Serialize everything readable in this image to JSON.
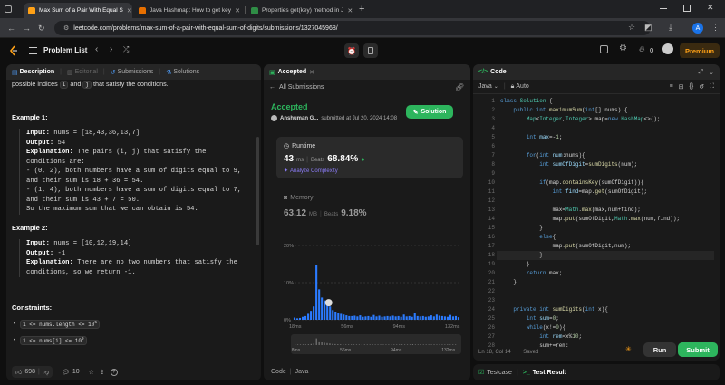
{
  "browser": {
    "tabs": [
      {
        "title": "Max Sum of a Pair With Equal S"
      },
      {
        "title": "Java Hashmap: How to get key"
      },
      {
        "title": "Properties get(key) method in J"
      }
    ],
    "new_tab": "+",
    "url": "leetcode.com/problems/max-sum-of-a-pair-with-equal-sum-of-digits/submissions/1327045968/",
    "profile_initial": "A"
  },
  "header": {
    "problem_list": "Problem List",
    "streak_count": "0",
    "premium": "Premium"
  },
  "left_panel": {
    "tabs": {
      "description": "Description",
      "editorial": "Editorial",
      "submissions": "Submissions",
      "solutions": "Solutions"
    },
    "intro_text": {
      "pre": "possible indices ",
      "i": "i",
      "mid": " and ",
      "j": "j",
      "post": " that satisfy the conditions."
    },
    "example1": {
      "heading": "Example 1:",
      "input_label": "Input:",
      "input_value": " nums = [18,43,36,13,7]",
      "output_label": "Output:",
      "output_value": " 54",
      "explanation_label": "Explanation:",
      "lines": [
        " The pairs (i, j) that satisfy the",
        "conditions are:",
        "- (0, 2), both numbers have a sum of digits equal to 9,",
        "and their sum is 18 + 36 = 54.",
        "- (1, 4), both numbers have a sum of digits equal to 7,",
        "and their sum is 43 + 7 = 50.",
        "So the maximum sum that we can obtain is 54."
      ]
    },
    "example2": {
      "heading": "Example 2:",
      "input_label": "Input:",
      "input_value": " nums = [10,12,19,14]",
      "output_label": "Output:",
      "output_value": " -1",
      "explanation_label": "Explanation:",
      "lines": [
        " There are no two numbers that satisfy the",
        "conditions, so we return -1."
      ]
    },
    "constraints": {
      "heading": "Constraints:",
      "items": [
        {
          "text": "1 <= nums.length <= 10",
          "sup": "5"
        },
        {
          "text": "1 <= nums[i] <= 10",
          "sup": "9"
        }
      ]
    },
    "likes": "698",
    "comments": "10"
  },
  "middle_panel": {
    "tab": "Accepted",
    "back": "All Submissions",
    "status": "Accepted",
    "user": "Anshuman G...",
    "submitted": "submitted at Jul 20, 2024 14:08",
    "solution_button": "Solution",
    "runtime": {
      "label": "Runtime",
      "value": "43",
      "unit": "ms",
      "beats_label": "Beats",
      "beats": "68.84%",
      "analyze": "Analyze Complexity"
    },
    "memory": {
      "label": "Memory",
      "value": "63.12",
      "unit": "MB",
      "beats_label": "Beats",
      "beats": "9.18%"
    },
    "chart_data": {
      "type": "bar",
      "title": "",
      "xlabel": "",
      "ylabel": "",
      "ylim": [
        0,
        20
      ],
      "y_ticks": [
        "20%",
        "10%",
        "0%"
      ],
      "x_ticks": [
        "18ms",
        "56ms",
        "94ms",
        "132ms"
      ],
      "xlim": [
        18,
        140
      ],
      "grid": true,
      "bar_color": "#2b7bff",
      "highlight_x": 43,
      "bars": [
        {
          "x": 18,
          "y": 0.6
        },
        {
          "x": 20,
          "y": 0.4
        },
        {
          "x": 22,
          "y": 0.5
        },
        {
          "x": 24,
          "y": 0.8
        },
        {
          "x": 26,
          "y": 1.0
        },
        {
          "x": 28,
          "y": 1.6
        },
        {
          "x": 30,
          "y": 2.4
        },
        {
          "x": 32,
          "y": 3.6
        },
        {
          "x": 34,
          "y": 14.8
        },
        {
          "x": 36,
          "y": 8.2
        },
        {
          "x": 38,
          "y": 6.0
        },
        {
          "x": 40,
          "y": 5.2
        },
        {
          "x": 42,
          "y": 4.4
        },
        {
          "x": 44,
          "y": 3.6
        },
        {
          "x": 46,
          "y": 2.6
        },
        {
          "x": 48,
          "y": 2.2
        },
        {
          "x": 50,
          "y": 1.8
        },
        {
          "x": 52,
          "y": 1.6
        },
        {
          "x": 54,
          "y": 1.4
        },
        {
          "x": 56,
          "y": 1.2
        },
        {
          "x": 58,
          "y": 1.0
        },
        {
          "x": 60,
          "y": 1.0
        },
        {
          "x": 62,
          "y": 1.1
        },
        {
          "x": 64,
          "y": 0.9
        },
        {
          "x": 66,
          "y": 1.2
        },
        {
          "x": 68,
          "y": 0.8
        },
        {
          "x": 70,
          "y": 0.9
        },
        {
          "x": 72,
          "y": 1.0
        },
        {
          "x": 74,
          "y": 0.8
        },
        {
          "x": 76,
          "y": 1.3
        },
        {
          "x": 78,
          "y": 0.9
        },
        {
          "x": 80,
          "y": 1.1
        },
        {
          "x": 82,
          "y": 0.8
        },
        {
          "x": 84,
          "y": 0.9
        },
        {
          "x": 86,
          "y": 1.0
        },
        {
          "x": 88,
          "y": 0.9
        },
        {
          "x": 90,
          "y": 1.1
        },
        {
          "x": 92,
          "y": 0.9
        },
        {
          "x": 94,
          "y": 1.0
        },
        {
          "x": 96,
          "y": 0.8
        },
        {
          "x": 98,
          "y": 1.4
        },
        {
          "x": 100,
          "y": 0.9
        },
        {
          "x": 102,
          "y": 1.0
        },
        {
          "x": 104,
          "y": 0.8
        },
        {
          "x": 106,
          "y": 1.8
        },
        {
          "x": 108,
          "y": 1.0
        },
        {
          "x": 110,
          "y": 0.9
        },
        {
          "x": 112,
          "y": 1.0
        },
        {
          "x": 114,
          "y": 0.8
        },
        {
          "x": 116,
          "y": 0.9
        },
        {
          "x": 118,
          "y": 1.2
        },
        {
          "x": 120,
          "y": 0.9
        },
        {
          "x": 122,
          "y": 1.4
        },
        {
          "x": 124,
          "y": 1.1
        },
        {
          "x": 126,
          "y": 1.0
        },
        {
          "x": 128,
          "y": 0.9
        },
        {
          "x": 130,
          "y": 0.8
        },
        {
          "x": 132,
          "y": 1.3
        },
        {
          "x": 134,
          "y": 0.9
        },
        {
          "x": 136,
          "y": 1.0
        },
        {
          "x": 138,
          "y": 0.7
        }
      ],
      "overview_ticks": [
        "18ms",
        "56ms",
        "94ms",
        "132ms"
      ]
    },
    "footer": {
      "code_label": "Code",
      "lang": "Java"
    }
  },
  "right_panel": {
    "tab": "Code",
    "lang": "Java",
    "auto": "Auto",
    "lines": [
      {
        "n": "1",
        "code": [
          [
            "kw",
            "class "
          ],
          [
            "ty",
            "Solution "
          ],
          [
            "pl",
            "{"
          ]
        ]
      },
      {
        "n": "2",
        "code": [
          [
            "pl",
            "    "
          ],
          [
            "kw",
            "public int "
          ],
          [
            "fn",
            "maximumSum"
          ],
          [
            "pl",
            "("
          ],
          [
            "kw",
            "int"
          ],
          [
            "pl",
            "[] nums) {"
          ]
        ]
      },
      {
        "n": "3",
        "code": [
          [
            "pl",
            "        "
          ],
          [
            "ty",
            "Map"
          ],
          [
            "pl",
            "<"
          ],
          [
            "ty",
            "Integer"
          ],
          [
            "pl",
            ","
          ],
          [
            "ty",
            "Integer"
          ],
          [
            "pl",
            "> map="
          ],
          [
            "kw",
            "new "
          ],
          [
            "ty",
            "HashMap"
          ],
          [
            "pl",
            "<>();"
          ]
        ]
      },
      {
        "n": "4",
        "code": []
      },
      {
        "n": "5",
        "code": [
          [
            "pl",
            "        "
          ],
          [
            "kw",
            "int "
          ],
          [
            "vr",
            "max"
          ],
          [
            "pl",
            "=-"
          ],
          [
            "nm",
            "1"
          ],
          [
            "pl",
            ";"
          ]
        ]
      },
      {
        "n": "6",
        "code": []
      },
      {
        "n": "7",
        "code": [
          [
            "pl",
            "        "
          ],
          [
            "kw",
            "for"
          ],
          [
            "pl",
            "("
          ],
          [
            "kw",
            "int "
          ],
          [
            "vr",
            "num"
          ],
          [
            "pl",
            ":nums){"
          ]
        ]
      },
      {
        "n": "8",
        "code": [
          [
            "pl",
            "            "
          ],
          [
            "kw",
            "int "
          ],
          [
            "vr",
            "sumOfDigit"
          ],
          [
            "pl",
            "="
          ],
          [
            "fn",
            "sumDigits"
          ],
          [
            "pl",
            "(num);"
          ]
        ]
      },
      {
        "n": "9",
        "code": []
      },
      {
        "n": "10",
        "code": [
          [
            "pl",
            "            "
          ],
          [
            "kw",
            "if"
          ],
          [
            "pl",
            "(map."
          ],
          [
            "fn",
            "containsKey"
          ],
          [
            "pl",
            "(sumOfDigit)){"
          ]
        ]
      },
      {
        "n": "11",
        "code": [
          [
            "pl",
            "                "
          ],
          [
            "kw",
            "int "
          ],
          [
            "vr",
            "find"
          ],
          [
            "pl",
            "=map."
          ],
          [
            "fn",
            "get"
          ],
          [
            "pl",
            "(sumOfDigit);"
          ]
        ]
      },
      {
        "n": "12",
        "code": []
      },
      {
        "n": "13",
        "code": [
          [
            "pl",
            "                max="
          ],
          [
            "ty",
            "Math"
          ],
          [
            "pl",
            "."
          ],
          [
            "fn",
            "max"
          ],
          [
            "pl",
            "(max,num+find);"
          ]
        ]
      },
      {
        "n": "14",
        "code": [
          [
            "pl",
            "                map."
          ],
          [
            "fn",
            "put"
          ],
          [
            "pl",
            "(sumOfDigit,"
          ],
          [
            "ty",
            "Math"
          ],
          [
            "pl",
            "."
          ],
          [
            "fn",
            "max"
          ],
          [
            "pl",
            "(num,find));"
          ]
        ]
      },
      {
        "n": "15",
        "code": [
          [
            "pl",
            "            }"
          ]
        ]
      },
      {
        "n": "16",
        "code": [
          [
            "pl",
            "            "
          ],
          [
            "kw",
            "else"
          ],
          [
            "pl",
            "{"
          ]
        ]
      },
      {
        "n": "17",
        "code": [
          [
            "pl",
            "                map."
          ],
          [
            "fn",
            "put"
          ],
          [
            "pl",
            "(sumOfDigit,num);"
          ]
        ]
      },
      {
        "n": "18",
        "code": [
          [
            "pl",
            "            }"
          ]
        ]
      },
      {
        "n": "19",
        "code": [
          [
            "pl",
            "        }"
          ]
        ]
      },
      {
        "n": "20",
        "code": [
          [
            "pl",
            "        "
          ],
          [
            "kw",
            "return "
          ],
          [
            "pl",
            "max;"
          ]
        ]
      },
      {
        "n": "21",
        "code": [
          [
            "pl",
            "    }"
          ]
        ]
      },
      {
        "n": "22",
        "code": []
      },
      {
        "n": "23",
        "code": []
      },
      {
        "n": "24",
        "code": [
          [
            "pl",
            "    "
          ],
          [
            "kw",
            "private int "
          ],
          [
            "fn",
            "sumDigits"
          ],
          [
            "pl",
            "("
          ],
          [
            "kw",
            "int "
          ],
          [
            "pl",
            "x){"
          ]
        ]
      },
      {
        "n": "25",
        "code": [
          [
            "pl",
            "        "
          ],
          [
            "kw",
            "int "
          ],
          [
            "vr",
            "sum"
          ],
          [
            "pl",
            "="
          ],
          [
            "nm",
            "0"
          ],
          [
            "pl",
            ";"
          ]
        ]
      },
      {
        "n": "26",
        "code": [
          [
            "pl",
            "        "
          ],
          [
            "kw",
            "while"
          ],
          [
            "pl",
            "(x!="
          ],
          [
            "nm",
            "0"
          ],
          [
            "pl",
            "){"
          ]
        ]
      },
      {
        "n": "27",
        "code": [
          [
            "pl",
            "            "
          ],
          [
            "kw",
            "int "
          ],
          [
            "vr",
            "rem"
          ],
          [
            "pl",
            "=x%"
          ],
          [
            "nm",
            "10"
          ],
          [
            "pl",
            ";"
          ]
        ]
      },
      {
        "n": "28",
        "code": [
          [
            "pl",
            "            sum+=rem;"
          ]
        ]
      }
    ],
    "status": "Ln 18, Col 14",
    "saved": "Saved",
    "run": "Run",
    "submit": "Submit",
    "bottom_tabs": {
      "testcase": "Testcase",
      "result": "Test Result"
    }
  }
}
